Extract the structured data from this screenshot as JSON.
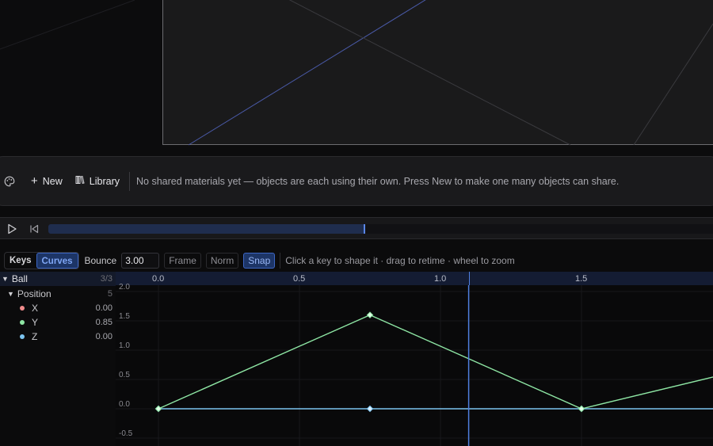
{
  "materials": {
    "new_label": "New",
    "library_label": "Library",
    "message": "No shared materials yet — objects are each using their own. Press New to make one many objects can share."
  },
  "transport": {
    "progress": 0.472
  },
  "curve_toolbar": {
    "keys_label": "Keys",
    "curves_label": "Curves",
    "active_mode": "Curves",
    "bounce_label": "Bounce",
    "bounce_value": "3.00",
    "frame_label": "Frame",
    "norm_label": "Norm",
    "snap_label": "Snap",
    "snap_on": true,
    "hint": "Click a key to shape it · drag to retime · wheel to zoom"
  },
  "tree": {
    "object": {
      "name": "Ball",
      "count": "3/3"
    },
    "group": {
      "name": "Position",
      "count": "5"
    },
    "channels": [
      {
        "name": "X",
        "value": "0.00",
        "color": "#f08c8c"
      },
      {
        "name": "Y",
        "value": "0.85",
        "color": "#8ee6a4"
      },
      {
        "name": "Z",
        "value": "0.00",
        "color": "#7cc4f0"
      }
    ]
  },
  "graph": {
    "x_ticks": [
      "0.0",
      "0.5",
      "1.0",
      "1.5"
    ],
    "x_tick_values": [
      0.0,
      0.5,
      1.0,
      1.5
    ],
    "y_ticks": [
      "2.0",
      "1.5",
      "1.0",
      "0.5",
      "0.0",
      "-0.5"
    ],
    "y_tick_values": [
      2.0,
      1.5,
      1.0,
      0.5,
      0.0,
      -0.5
    ],
    "playhead_time": 1.1,
    "y_curve_keys": [
      [
        0.0,
        0.0
      ],
      [
        0.75,
        1.6
      ],
      [
        1.5,
        0.0
      ],
      [
        2.06,
        0.65
      ]
    ],
    "flat_curve_keys": [
      [
        0.0,
        0.0
      ],
      [
        0.75,
        0.0
      ],
      [
        1.5,
        0.0
      ]
    ],
    "y_color": "#8ee6a4",
    "flat_color": "#7cc4f0",
    "accent": "#4f7fe0"
  }
}
